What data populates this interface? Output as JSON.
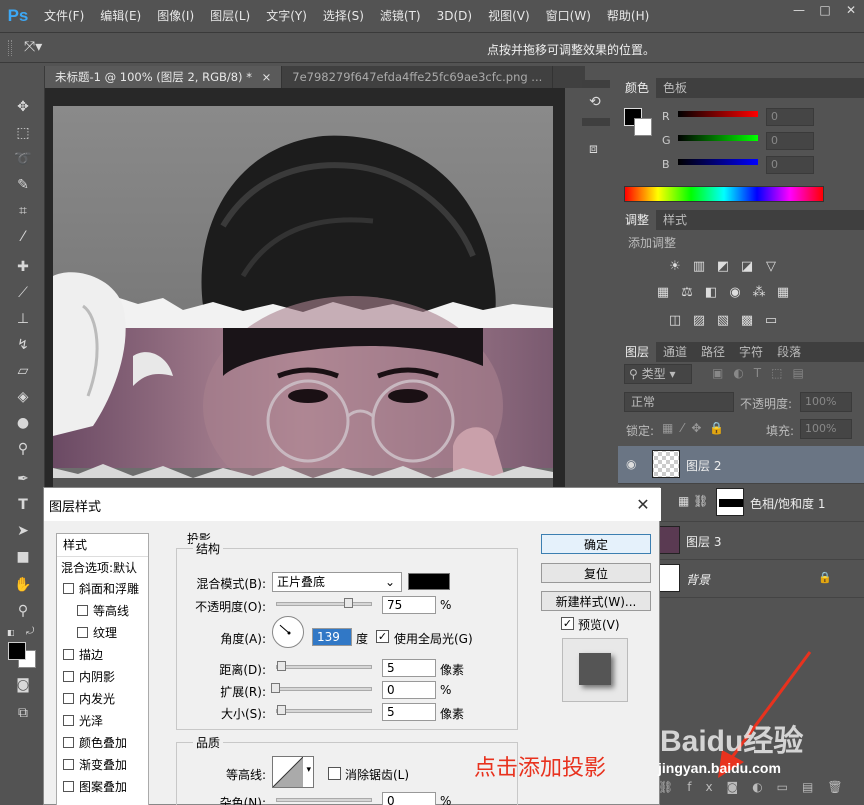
{
  "app": {
    "logo": "Ps"
  },
  "menu": [
    "文件(F)",
    "编辑(E)",
    "图像(I)",
    "图层(L)",
    "文字(Y)",
    "选择(S)",
    "滤镜(T)",
    "3D(D)",
    "视图(V)",
    "窗口(W)",
    "帮助(H)"
  ],
  "window_controls": {
    "minimize": "—",
    "maximize": "□",
    "close": "✕"
  },
  "options_bar": {
    "hint": "点按并拖移可调整效果的位置。"
  },
  "tabs": [
    {
      "label": "未标题-1 @ 100% (图层 2, RGB/8) *",
      "close": "×"
    },
    {
      "label": "7e798279f647efda4ffe25fc69ae3cfc.png ..."
    }
  ],
  "color_panel": {
    "tabs": [
      "颜色",
      "色板"
    ],
    "rows": [
      {
        "label": "R",
        "value": "0",
        "color": "#ff0000"
      },
      {
        "label": "G",
        "value": "0",
        "color": "#00ff00"
      },
      {
        "label": "B",
        "value": "0",
        "color": "#0000ff"
      }
    ]
  },
  "adjustments_panel": {
    "tabs": [
      "调整",
      "样式"
    ],
    "heading": "添加调整"
  },
  "layers_panel": {
    "tabs": [
      "图层",
      "通道",
      "路径",
      "字符",
      "段落"
    ],
    "filter_kind": "类型",
    "blend_mode": "正常",
    "opacity_label": "不透明度:",
    "opacity_value": "100%",
    "lock_label": "锁定:",
    "fill_label": "填充:",
    "fill_value": "100%",
    "layers": [
      {
        "name": "图层 2",
        "selected": true
      },
      {
        "name": "色相/饱和度 1",
        "selected": false
      },
      {
        "name": "图层 3",
        "selected": false
      },
      {
        "name": "背景",
        "selected": false
      }
    ]
  },
  "dialog": {
    "title": "图层样式",
    "close": "✕",
    "style_list": {
      "header": "样式",
      "blend_default": "混合选项:默认",
      "items": [
        {
          "label": "斜面和浮雕",
          "indent": false
        },
        {
          "label": "等高线",
          "indent": true
        },
        {
          "label": "纹理",
          "indent": true
        },
        {
          "label": "描边",
          "indent": false
        },
        {
          "label": "内阴影",
          "indent": false
        },
        {
          "label": "内发光",
          "indent": false
        },
        {
          "label": "光泽",
          "indent": false
        },
        {
          "label": "颜色叠加",
          "indent": false
        },
        {
          "label": "渐变叠加",
          "indent": false
        },
        {
          "label": "图案叠加",
          "indent": false
        }
      ]
    },
    "drop_shadow": {
      "section": "投影",
      "structure": "结构",
      "blend_mode_label": "混合模式(B):",
      "blend_mode_value": "正片叠底",
      "shadow_color": "#000000",
      "opacity_label": "不透明度(O):",
      "opacity_value": "75",
      "opacity_unit": "%",
      "opacity_level": 0.75,
      "angle_label": "角度(A):",
      "angle_value": "139",
      "angle_unit": "度",
      "global_light_label": "使用全局光(G)",
      "global_light_checked": true,
      "distance_label": "距离(D):",
      "distance_value": "5",
      "distance_unit": "像素",
      "spread_label": "扩展(R):",
      "spread_value": "0",
      "spread_unit": "%",
      "size_label": "大小(S):",
      "size_value": "5",
      "size_unit": "像素",
      "quality": "品质",
      "contour_label": "等高线:",
      "antialias_label": "消除锯齿(L)",
      "noise_label": "杂色(N):",
      "noise_value": "0",
      "noise_unit": "%"
    },
    "buttons": {
      "ok": "确定",
      "reset": "复位",
      "new_style": "新建样式(W)...",
      "preview_label": "预览(V)",
      "preview_checked": true
    }
  },
  "annotation": {
    "text": "点击添加投影"
  },
  "watermark": {
    "brand": "Baidu经验",
    "url": "jingyan.baidu.com"
  }
}
